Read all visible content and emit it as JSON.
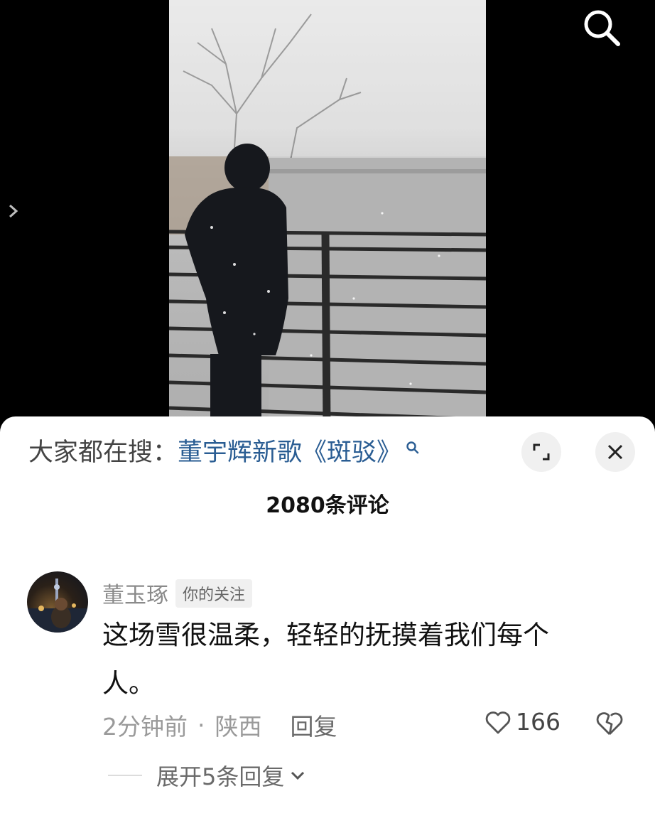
{
  "video": {
    "icons": [
      "search-icon",
      "chevron-right-icon"
    ]
  },
  "sheet": {
    "search_prefix": "大家都在搜：",
    "search_term": "董宇辉新歌《斑驳》",
    "comment_count": "2080条评论"
  },
  "comment": {
    "username": "董玉琢",
    "badge": "你的关注",
    "text": "这场雪很温柔，轻轻的抚摸着我们每个人。",
    "time": "2分钟前",
    "separator": "·",
    "location": "陕西",
    "reply_label": "回复",
    "likes": "166",
    "expand_replies": "展开5条回复"
  },
  "colors": {
    "link_blue": "#2a5d93",
    "sheet_bg": "#ffffff",
    "video_bg": "#000000"
  }
}
